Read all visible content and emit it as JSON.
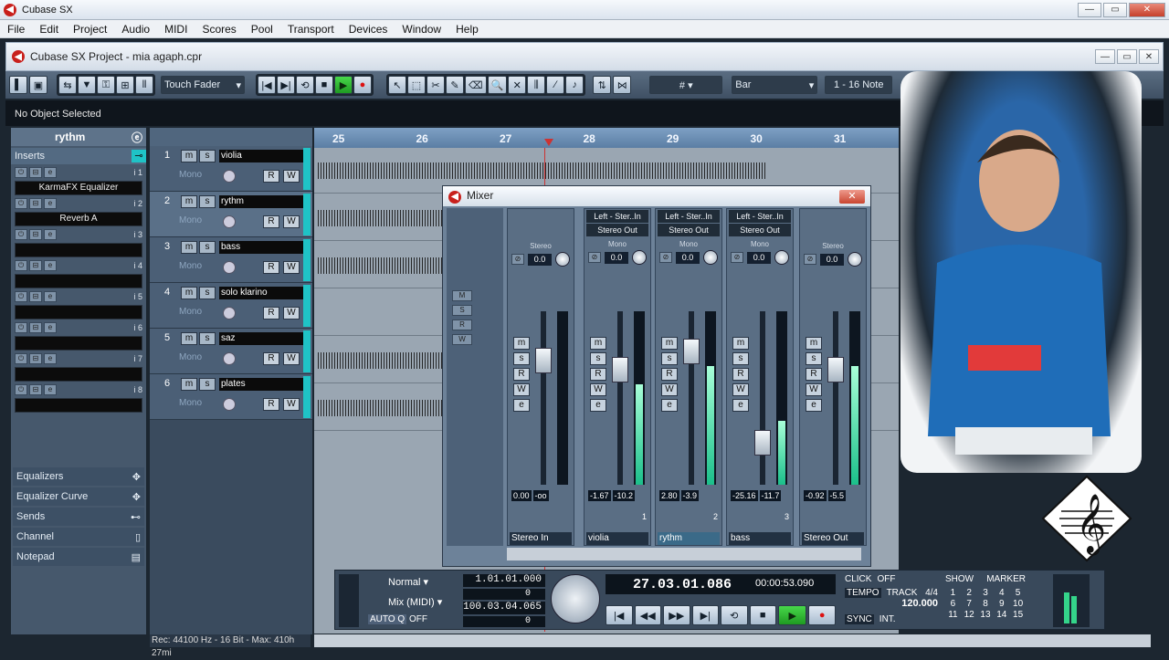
{
  "app": {
    "title": "Cubase SX",
    "window_buttons": [
      "—",
      "▭",
      "✕"
    ]
  },
  "menu": [
    "File",
    "Edit",
    "Project",
    "Audio",
    "MIDI",
    "Scores",
    "Pool",
    "Transport",
    "Devices",
    "Window",
    "Help"
  ],
  "project": {
    "title": "Cubase SX Project - mia agaph.cpr"
  },
  "toolbar": {
    "automation_mode": "Touch Fader",
    "snap_type": "Bar",
    "quantize": "1 - 16 Note"
  },
  "info_line": "No Object Selected",
  "inspector": {
    "track_name": "rythm",
    "inserts_label": "Inserts",
    "insert_slots": [
      {
        "name": "KarmaFX Equalizer",
        "num": "i 1"
      },
      {
        "name": "Reverb A",
        "num": "i 2"
      },
      {
        "name": "",
        "num": "i 3"
      },
      {
        "name": "",
        "num": "i 4"
      },
      {
        "name": "",
        "num": "i 5"
      },
      {
        "name": "",
        "num": "i 6"
      },
      {
        "name": "",
        "num": "i 7"
      },
      {
        "name": "",
        "num": "i 8"
      }
    ],
    "sections": [
      "Equalizers",
      "Equalizer Curve",
      "Sends",
      "Channel",
      "Notepad"
    ]
  },
  "tracks": [
    {
      "num": "1",
      "name": "violia",
      "mode": "Mono"
    },
    {
      "num": "2",
      "name": "rythm",
      "mode": "Mono"
    },
    {
      "num": "3",
      "name": "bass",
      "mode": "Mono"
    },
    {
      "num": "4",
      "name": "solo klarino",
      "mode": "Mono"
    },
    {
      "num": "5",
      "name": "saz",
      "mode": "Mono"
    },
    {
      "num": "6",
      "name": "plates",
      "mode": "Mono"
    }
  ],
  "ruler": [
    "25",
    "26",
    "27",
    "28",
    "29",
    "30",
    "31"
  ],
  "mixer": {
    "title": "Mixer",
    "strips": [
      {
        "name": "Stereo In",
        "route_in": "",
        "route_out": "",
        "pan_label": "Stereo",
        "pan": "0.0",
        "vol": "0.00",
        "peak": "-oo",
        "num": ""
      },
      {
        "name": "violia",
        "route_in": "Left - Ster..In",
        "route_out": "Stereo Out",
        "pan_label": "Mono",
        "pan": "0.0",
        "vol": "-1.67",
        "peak": "-10.2",
        "num": "1"
      },
      {
        "name": "rythm",
        "route_in": "Left - Ster..In",
        "route_out": "Stereo Out",
        "pan_label": "Mono",
        "pan": "0.0",
        "vol": "2.80",
        "peak": "-3.9",
        "num": "2"
      },
      {
        "name": "bass",
        "route_in": "Left - Ster..In",
        "route_out": "Stereo Out",
        "pan_label": "Mono",
        "pan": "0.0",
        "vol": "-25.16",
        "peak": "-11.7",
        "num": "3"
      },
      {
        "name": "Stereo Out",
        "route_in": "",
        "route_out": "",
        "pan_label": "Stereo",
        "pan": "0.0",
        "vol": "-0.92",
        "peak": "-5.5",
        "num": ""
      }
    ]
  },
  "transport": {
    "mode": "Normal",
    "mix": "Mix (MIDI)",
    "auto": "AUTO Q",
    "auto_state": "OFF",
    "left_locator": "1.01.01.000",
    "left_small": "0",
    "right_locator": "100.03.04.065",
    "right_small": "0",
    "position": "27.03.01.086",
    "time": "00:00:53.090",
    "click": "CLICK",
    "click_state": "OFF",
    "tempo": "TEMPO",
    "track": "TRACK",
    "signature": "4/4",
    "bpm": "120.000",
    "sync": "SYNC",
    "sync_state": "INT.",
    "show": "SHOW",
    "marker": "MARKER",
    "markers": [
      "1",
      "2",
      "3",
      "4",
      "5",
      "6",
      "7",
      "8",
      "9",
      "10",
      "11",
      "12",
      "13",
      "14",
      "15"
    ]
  },
  "status": "Rec: 44100 Hz - 16 Bit - Max: 410h 27mi"
}
